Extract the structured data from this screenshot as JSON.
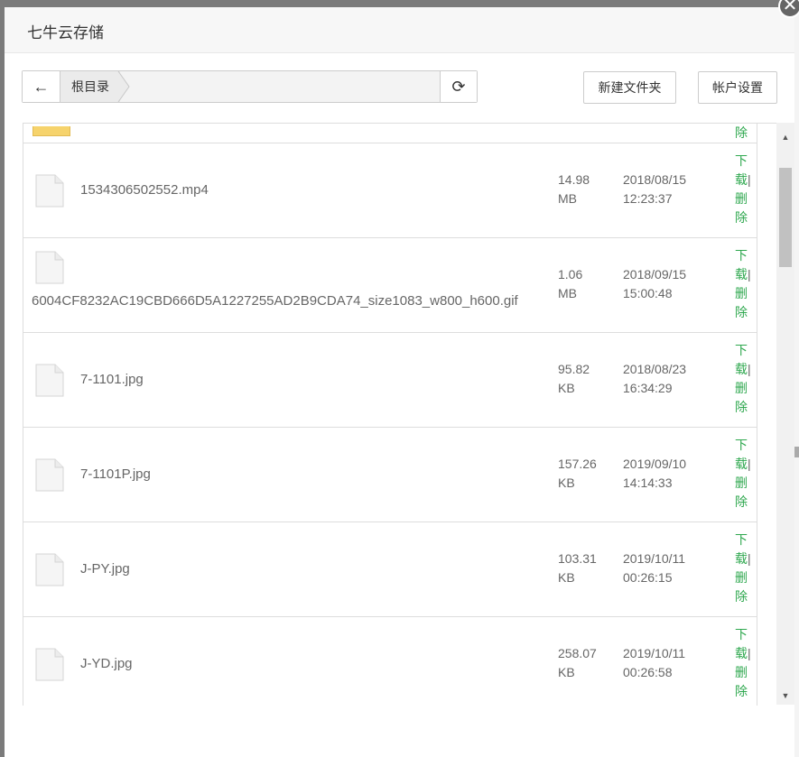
{
  "modal": {
    "title": "七牛云存储",
    "close_label": "✕"
  },
  "toolbar": {
    "back_label": "←",
    "breadcrumb_root": "根目录",
    "refresh_label": "⟳",
    "new_folder_label": "新建文件夹",
    "account_settings_label": "帐户设置"
  },
  "actions": {
    "download_1": "下",
    "download_2": "载",
    "separator": "|",
    "delete_1": "删",
    "delete_2": "除"
  },
  "partial_row": {
    "visible_action": "除"
  },
  "files": [
    {
      "name": "1534306502552.mp4",
      "size_value": "14.98",
      "size_unit": "MB",
      "date": "2018/08/15",
      "time": "12:23:37"
    },
    {
      "name": "6004CF8232AC19CBD666D5A1227255AD2B9CDA74_size1083_w800_h600.gif",
      "size_value": "1.06",
      "size_unit": "MB",
      "date": "2018/09/15",
      "time": "15:00:48"
    },
    {
      "name": "7-1101.jpg",
      "size_value": "95.82",
      "size_unit": "KB",
      "date": "2018/08/23",
      "time": "16:34:29"
    },
    {
      "name": "7-1101P.jpg",
      "size_value": "157.26",
      "size_unit": "KB",
      "date": "2019/09/10",
      "time": "14:14:33"
    },
    {
      "name": "J-PY.jpg",
      "size_value": "103.31",
      "size_unit": "KB",
      "date": "2019/10/11",
      "time": "00:26:15"
    },
    {
      "name": "J-YD.jpg",
      "size_value": "258.07",
      "size_unit": "KB",
      "date": "2019/10/11",
      "time": "00:26:58"
    }
  ],
  "scrollbar": {
    "up_arrow": "▲",
    "down_arrow": "▼"
  }
}
